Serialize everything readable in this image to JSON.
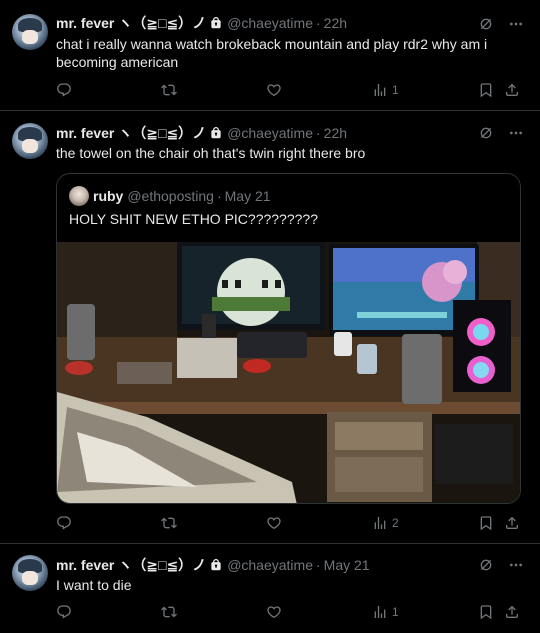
{
  "tweets": [
    {
      "name": "mr. fever ヽ（≧□≦）ノ",
      "handle": "@chaeyatime",
      "dot": "·",
      "time": "22h",
      "text": "chat i really wanna watch brokeback mountain and play rdr2 why am i becoming american",
      "views": "1"
    },
    {
      "name": "mr. fever ヽ（≧□≦）ノ",
      "handle": "@chaeyatime",
      "dot": "·",
      "time": "22h",
      "text": "the towel on the chair oh that's twin right there bro",
      "views": "2",
      "quote": {
        "name": "ruby",
        "handle": "@ethoposting",
        "dot": "·",
        "time": "May 21",
        "text": "HOLY SHIT NEW ETHO PIC?????????"
      }
    },
    {
      "name": "mr. fever ヽ（≧□≦）ノ",
      "handle": "@chaeyatime",
      "dot": "·",
      "time": "May 21",
      "text": "I want to die",
      "views": "1"
    }
  ],
  "icons": {
    "lock": "lock-icon",
    "grok": "grok-icon",
    "more": "more-icon",
    "reply": "reply-icon",
    "retweet": "retweet-icon",
    "like": "like-icon",
    "views": "views-icon",
    "bookmark": "bookmark-icon",
    "share": "share-icon"
  },
  "colors": {
    "background": "#000000",
    "text": "#e7e9ea",
    "muted": "#71767b",
    "divider": "#2f3336"
  }
}
